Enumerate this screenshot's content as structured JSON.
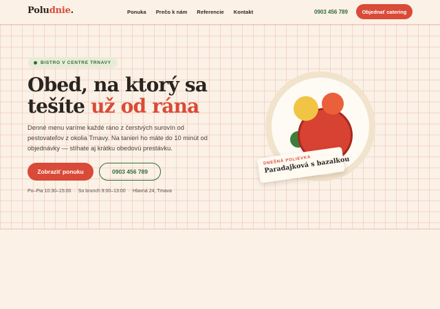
{
  "header": {
    "logo_main": "Polu",
    "logo_accent": "dnie",
    "logo_dot": ".",
    "nav": [
      "Ponuka",
      "Prečo k nám",
      "Referencie",
      "Kontakt"
    ],
    "phone": "0903 456 789",
    "cta": "Objednať catering"
  },
  "hero": {
    "badge": "BISTRO V CENTRE TRNAVY",
    "headline_line1": "Obed, na ktorý sa",
    "headline_line2_plain": "tešíte",
    "headline_line2_accent": "už od rána",
    "lead": "Denné menu varíme každé ráno z čerstvých surovín od pestovateľov z okolia Trnavy. Na tanieri ho máte do 10 minút od objednávky — stíhate aj krátku obedovú prestávku.",
    "primary_button": "Zobraziť ponuku",
    "secondary_button": "0903 456 789",
    "meta": {
      "hours_weekday": "Po–Pia 10:30–15:00",
      "hours_saturday": "So brunch 9:00–13:00",
      "address": "Hlavná 24, Trnava",
      "separator": "·"
    }
  },
  "soup_card": {
    "label": "DNEŠNÁ POLIEVKA",
    "name": "Paradajková s bazalkou"
  },
  "colors": {
    "accent": "#d94a38",
    "green": "#2f6b3a",
    "background": "#fbf1e6",
    "text": "#2a2420"
  }
}
